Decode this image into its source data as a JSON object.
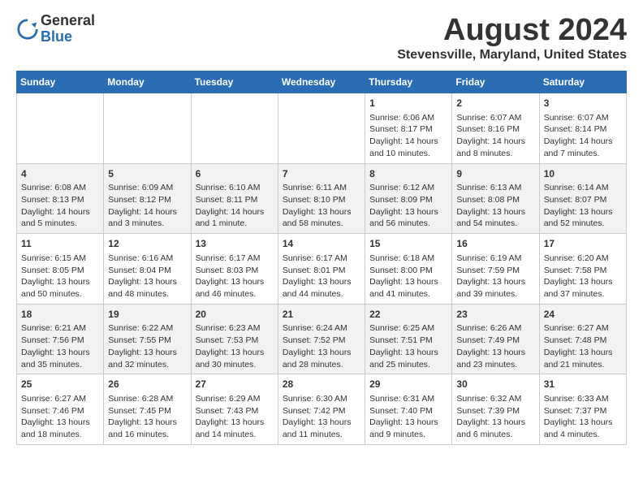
{
  "logo": {
    "general": "General",
    "blue": "Blue"
  },
  "title": "August 2024",
  "subtitle": "Stevensville, Maryland, United States",
  "days_header": [
    "Sunday",
    "Monday",
    "Tuesday",
    "Wednesday",
    "Thursday",
    "Friday",
    "Saturday"
  ],
  "weeks": [
    [
      {
        "day": "",
        "info": ""
      },
      {
        "day": "",
        "info": ""
      },
      {
        "day": "",
        "info": ""
      },
      {
        "day": "",
        "info": ""
      },
      {
        "day": "1",
        "info": "Sunrise: 6:06 AM\nSunset: 8:17 PM\nDaylight: 14 hours\nand 10 minutes."
      },
      {
        "day": "2",
        "info": "Sunrise: 6:07 AM\nSunset: 8:16 PM\nDaylight: 14 hours\nand 8 minutes."
      },
      {
        "day": "3",
        "info": "Sunrise: 6:07 AM\nSunset: 8:14 PM\nDaylight: 14 hours\nand 7 minutes."
      }
    ],
    [
      {
        "day": "4",
        "info": "Sunrise: 6:08 AM\nSunset: 8:13 PM\nDaylight: 14 hours\nand 5 minutes."
      },
      {
        "day": "5",
        "info": "Sunrise: 6:09 AM\nSunset: 8:12 PM\nDaylight: 14 hours\nand 3 minutes."
      },
      {
        "day": "6",
        "info": "Sunrise: 6:10 AM\nSunset: 8:11 PM\nDaylight: 14 hours\nand 1 minute."
      },
      {
        "day": "7",
        "info": "Sunrise: 6:11 AM\nSunset: 8:10 PM\nDaylight: 13 hours\nand 58 minutes."
      },
      {
        "day": "8",
        "info": "Sunrise: 6:12 AM\nSunset: 8:09 PM\nDaylight: 13 hours\nand 56 minutes."
      },
      {
        "day": "9",
        "info": "Sunrise: 6:13 AM\nSunset: 8:08 PM\nDaylight: 13 hours\nand 54 minutes."
      },
      {
        "day": "10",
        "info": "Sunrise: 6:14 AM\nSunset: 8:07 PM\nDaylight: 13 hours\nand 52 minutes."
      }
    ],
    [
      {
        "day": "11",
        "info": "Sunrise: 6:15 AM\nSunset: 8:05 PM\nDaylight: 13 hours\nand 50 minutes."
      },
      {
        "day": "12",
        "info": "Sunrise: 6:16 AM\nSunset: 8:04 PM\nDaylight: 13 hours\nand 48 minutes."
      },
      {
        "day": "13",
        "info": "Sunrise: 6:17 AM\nSunset: 8:03 PM\nDaylight: 13 hours\nand 46 minutes."
      },
      {
        "day": "14",
        "info": "Sunrise: 6:17 AM\nSunset: 8:01 PM\nDaylight: 13 hours\nand 44 minutes."
      },
      {
        "day": "15",
        "info": "Sunrise: 6:18 AM\nSunset: 8:00 PM\nDaylight: 13 hours\nand 41 minutes."
      },
      {
        "day": "16",
        "info": "Sunrise: 6:19 AM\nSunset: 7:59 PM\nDaylight: 13 hours\nand 39 minutes."
      },
      {
        "day": "17",
        "info": "Sunrise: 6:20 AM\nSunset: 7:58 PM\nDaylight: 13 hours\nand 37 minutes."
      }
    ],
    [
      {
        "day": "18",
        "info": "Sunrise: 6:21 AM\nSunset: 7:56 PM\nDaylight: 13 hours\nand 35 minutes."
      },
      {
        "day": "19",
        "info": "Sunrise: 6:22 AM\nSunset: 7:55 PM\nDaylight: 13 hours\nand 32 minutes."
      },
      {
        "day": "20",
        "info": "Sunrise: 6:23 AM\nSunset: 7:53 PM\nDaylight: 13 hours\nand 30 minutes."
      },
      {
        "day": "21",
        "info": "Sunrise: 6:24 AM\nSunset: 7:52 PM\nDaylight: 13 hours\nand 28 minutes."
      },
      {
        "day": "22",
        "info": "Sunrise: 6:25 AM\nSunset: 7:51 PM\nDaylight: 13 hours\nand 25 minutes."
      },
      {
        "day": "23",
        "info": "Sunrise: 6:26 AM\nSunset: 7:49 PM\nDaylight: 13 hours\nand 23 minutes."
      },
      {
        "day": "24",
        "info": "Sunrise: 6:27 AM\nSunset: 7:48 PM\nDaylight: 13 hours\nand 21 minutes."
      }
    ],
    [
      {
        "day": "25",
        "info": "Sunrise: 6:27 AM\nSunset: 7:46 PM\nDaylight: 13 hours\nand 18 minutes."
      },
      {
        "day": "26",
        "info": "Sunrise: 6:28 AM\nSunset: 7:45 PM\nDaylight: 13 hours\nand 16 minutes."
      },
      {
        "day": "27",
        "info": "Sunrise: 6:29 AM\nSunset: 7:43 PM\nDaylight: 13 hours\nand 14 minutes."
      },
      {
        "day": "28",
        "info": "Sunrise: 6:30 AM\nSunset: 7:42 PM\nDaylight: 13 hours\nand 11 minutes."
      },
      {
        "day": "29",
        "info": "Sunrise: 6:31 AM\nSunset: 7:40 PM\nDaylight: 13 hours\nand 9 minutes."
      },
      {
        "day": "30",
        "info": "Sunrise: 6:32 AM\nSunset: 7:39 PM\nDaylight: 13 hours\nand 6 minutes."
      },
      {
        "day": "31",
        "info": "Sunrise: 6:33 AM\nSunset: 7:37 PM\nDaylight: 13 hours\nand 4 minutes."
      }
    ]
  ]
}
